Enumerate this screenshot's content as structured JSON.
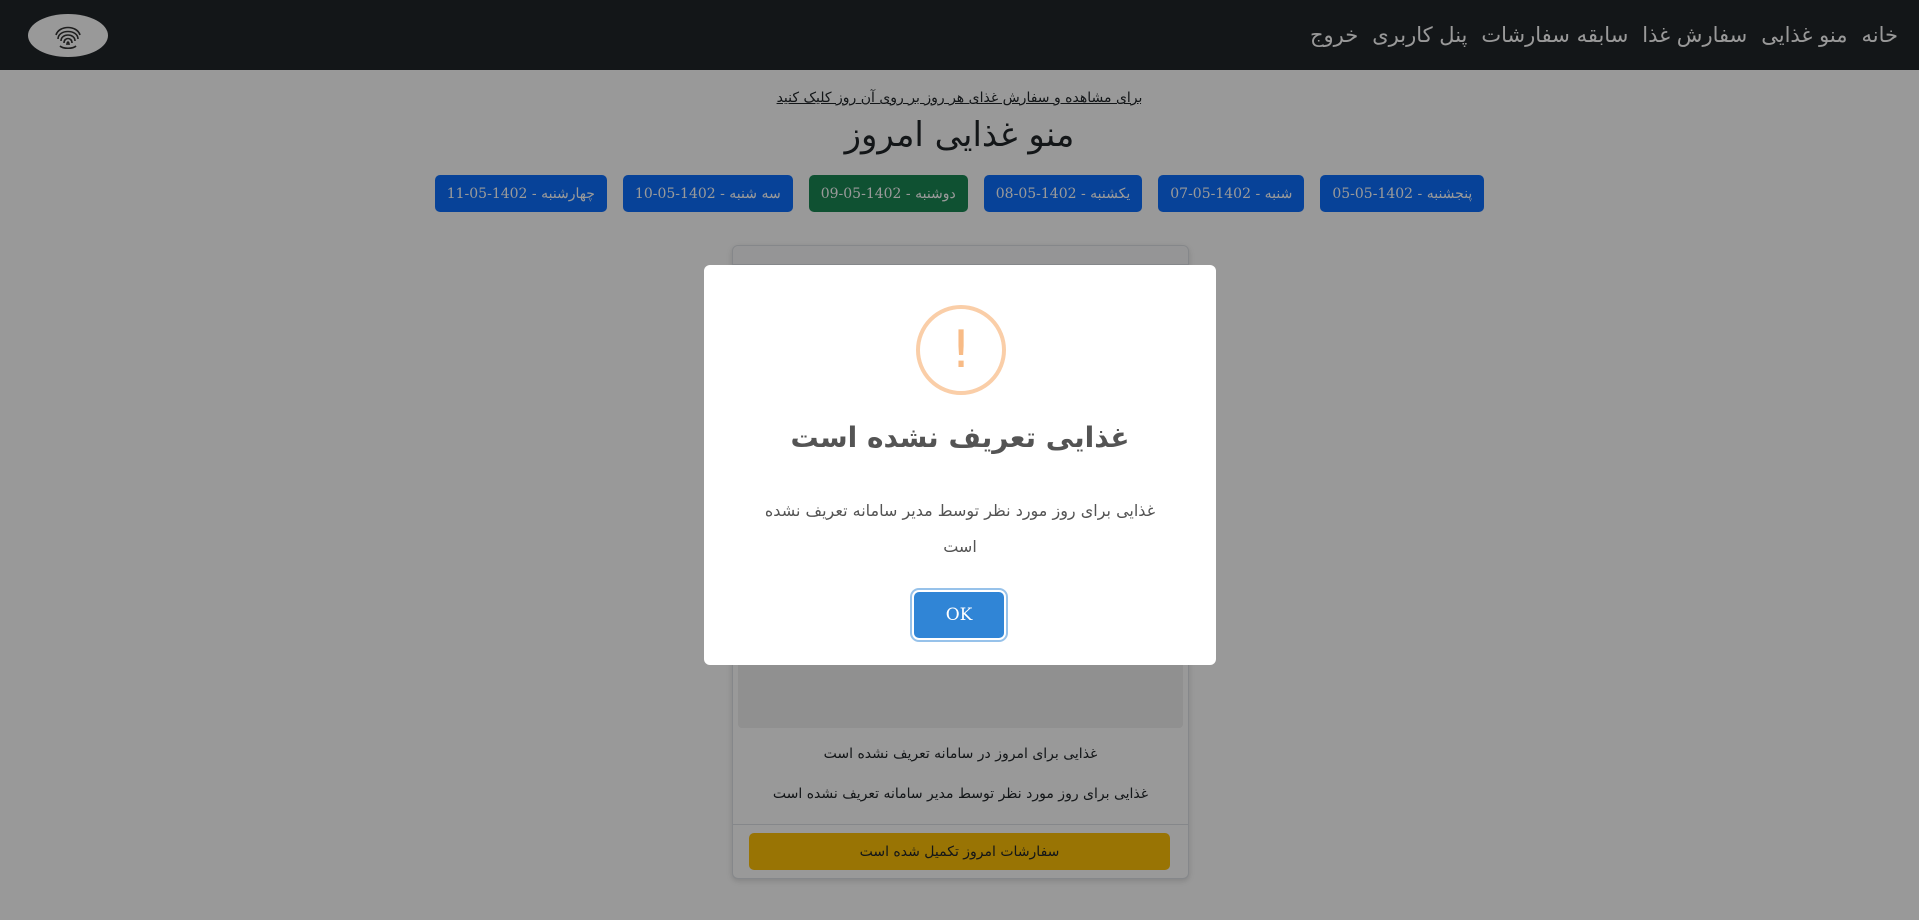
{
  "navbar": {
    "links": [
      "خانه",
      "منو غذایی",
      "سفارش غذا",
      "سابقه سفارشات",
      "پنل کاربری",
      "خروج"
    ]
  },
  "main": {
    "hint": "برای مشاهده و سفارش غذای هر روز بر روی آن روز کلیک کنید",
    "title": "منو غذایی امروز",
    "days": [
      {
        "label": "پنجشنبه - 1402-05-05",
        "active": false
      },
      {
        "label": "شنبه - 1402-05-07",
        "active": false
      },
      {
        "label": "یکشنبه - 1402-05-08",
        "active": false
      },
      {
        "label": "دوشنبه - 1402-05-09",
        "active": true
      },
      {
        "label": "سه شنبه - 1402-05-10",
        "active": false
      },
      {
        "label": "چهارشنبه - 1402-05-11",
        "active": false
      }
    ]
  },
  "card": {
    "line1": "غذایی برای امروز در سامانه تعریف نشده است",
    "line2": "غذایی برای روز مورد نظر توسط مدیر سامانه تعریف نشده است",
    "order_status": "سفارشات امروز تکمیل شده است"
  },
  "modal": {
    "icon": "!",
    "title": "غذایی تعریف نشده است",
    "text": "غذایی برای روز مورد نظر توسط مدیر سامانه تعریف نشده است",
    "ok_label": "OK"
  },
  "colors": {
    "navbar": "#212529",
    "primary": "#0d6efd",
    "success": "#198754",
    "warning": "#ffc107",
    "confirm": "#3085d6"
  }
}
